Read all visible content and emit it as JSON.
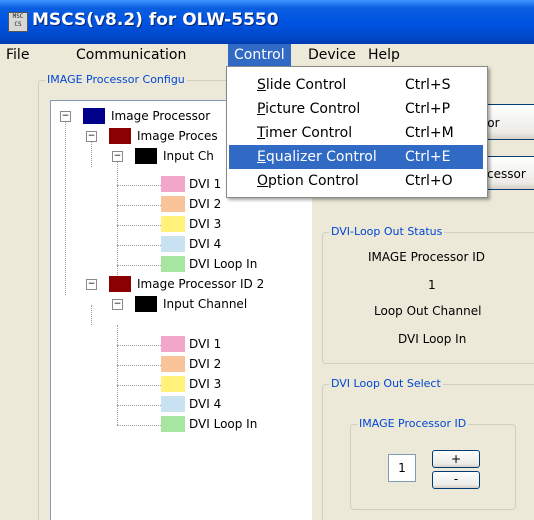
{
  "window": {
    "title": "MSCS(v8.2) for OLW-5550",
    "icon": "app-icon"
  },
  "menubar": {
    "items": [
      {
        "label": "File"
      },
      {
        "label": "Communication"
      },
      {
        "label": "Control"
      },
      {
        "label": "Device"
      },
      {
        "label": "Help"
      }
    ],
    "open_menu": "Control"
  },
  "control_menu": [
    {
      "label": "Slide Control",
      "mnemonic": "S",
      "rest": "lide Control",
      "shortcut": "Ctrl+S"
    },
    {
      "label": "Picture Control",
      "mnemonic": "P",
      "rest": "icture Control",
      "shortcut": "Ctrl+P"
    },
    {
      "label": "Timer Control",
      "mnemonic": "T",
      "rest": "imer Control",
      "shortcut": "Ctrl+M"
    },
    {
      "label": "Equalizer Control",
      "mnemonic": "E",
      "rest": "qualizer Control",
      "shortcut": "Ctrl+E"
    },
    {
      "label": "Option Control",
      "mnemonic": "O",
      "rest": "ption Control",
      "shortcut": "Ctrl+O"
    }
  ],
  "left_group_label": "IMAGE Processor Configu",
  "tree": {
    "root1": {
      "label": "Image Processor",
      "color": "#00008b"
    },
    "proc1": {
      "label": "Image Proces",
      "color": "#8b0000"
    },
    "chan1": {
      "label": "Input Ch",
      "color": "#000000"
    },
    "proc1_inputs": [
      {
        "label": "DVI 1",
        "color": "#f4a6c8"
      },
      {
        "label": "DVI 2",
        "color": "#f9c49a"
      },
      {
        "label": "DVI 3",
        "color": "#fff17a"
      },
      {
        "label": "DVI 4",
        "color": "#c9e2f2"
      },
      {
        "label": "DVI Loop In",
        "color": "#a6e6a0"
      }
    ],
    "proc2": {
      "label": "Image Processor ID 2",
      "color": "#8b0000"
    },
    "chan2": {
      "label": "Input Channel",
      "color": "#000000"
    },
    "proc2_inputs": [
      {
        "label": "DVI 1",
        "color": "#f4a6c8"
      },
      {
        "label": "DVI 2",
        "color": "#f9c49a"
      },
      {
        "label": "DVI 3",
        "color": "#fff17a"
      },
      {
        "label": "DVI 4",
        "color": "#c9e2f2"
      },
      {
        "label": "DVI Loop In",
        "color": "#a6e6a0"
      }
    ]
  },
  "right": {
    "button1": "sor",
    "button2": "cessor",
    "status": {
      "label": "DVI-Loop Out Status",
      "id_label": "IMAGE Processor ID",
      "id_value": "1",
      "channel_label": "Loop Out Channel",
      "channel_value": "DVI Loop In"
    },
    "select": {
      "label": "DVI Loop Out Select",
      "inner_label": "IMAGE Processor ID",
      "value": "1",
      "plus": "+",
      "minus": "-"
    }
  }
}
